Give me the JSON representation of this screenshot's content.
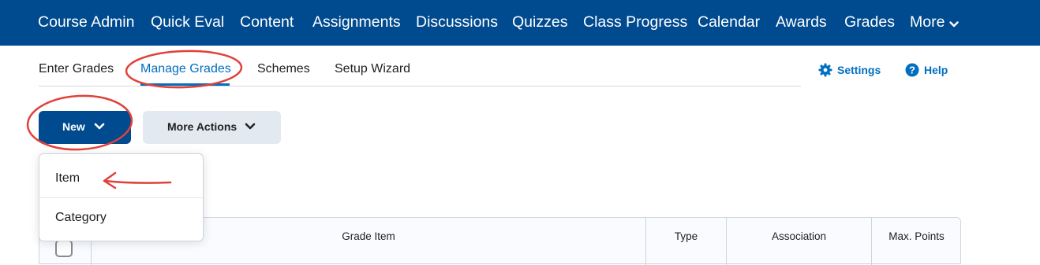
{
  "navbar": {
    "items": [
      "Course Admin",
      "Quick Eval",
      "Content",
      "Assignments",
      "Discussions",
      "Quizzes",
      "Class Progress",
      "Calendar",
      "Awards",
      "Grades",
      "More"
    ],
    "background": "#004a8f"
  },
  "subnav": {
    "tabs": [
      "Enter Grades",
      "Manage Grades",
      "Schemes",
      "Setup Wizard"
    ],
    "active_tab": "Manage Grades",
    "settings_label": "Settings",
    "help_label": "Help",
    "accent": "#006fbf"
  },
  "toolbar": {
    "new_label": "New",
    "more_actions_label": "More Actions"
  },
  "new_menu": {
    "items": [
      "Item",
      "Category"
    ]
  },
  "grade_table": {
    "columns": [
      "Grade Item",
      "Type",
      "Association",
      "Max. Points"
    ]
  },
  "annotation_color": "#e0413a"
}
